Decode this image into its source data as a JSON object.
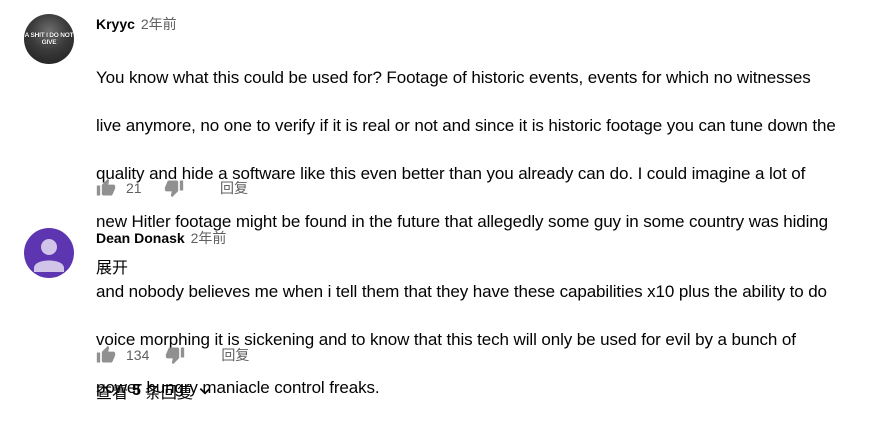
{
  "comments": [
    {
      "author": "Kryyc",
      "time": "2年前",
      "avatar_caption": "A SHIT I DO NOT GIVE",
      "text_lines": [
        "You know what this could be used for? Footage of historic events, events for which no witnesses",
        "live anymore, no one to verify if it is real or not and since it is historic footage you can tune down the",
        "quality and hide a software like this even better than you already can do. I could imagine a lot of",
        "new Hitler footage might be found in the future that allegedly some guy in some country was hiding"
      ],
      "expand_label": "展开",
      "likes": "21",
      "reply_label": "回复",
      "icons": {
        "like": "thumb-up-icon",
        "dislike": "thumb-down-icon"
      }
    },
    {
      "author": "Dean Donask",
      "time": "2年前",
      "avatar_color": "#5e35b1",
      "text_lines": [
        "and nobody believes me when i tell them that they have these capabilities x10 plus the ability to do",
        "voice morphing it is sickening and to know that this tech will only be used for evil by a bunch of",
        "power hungry maniacle control freaks."
      ],
      "likes": "134",
      "reply_label": "回复",
      "icons": {
        "like": "thumb-up-icon",
        "dislike": "thumb-down-icon"
      }
    }
  ],
  "view_replies": {
    "prefix": "查看",
    "count": "5",
    "suffix": "条回复",
    "icon": "chevron-down-icon"
  }
}
